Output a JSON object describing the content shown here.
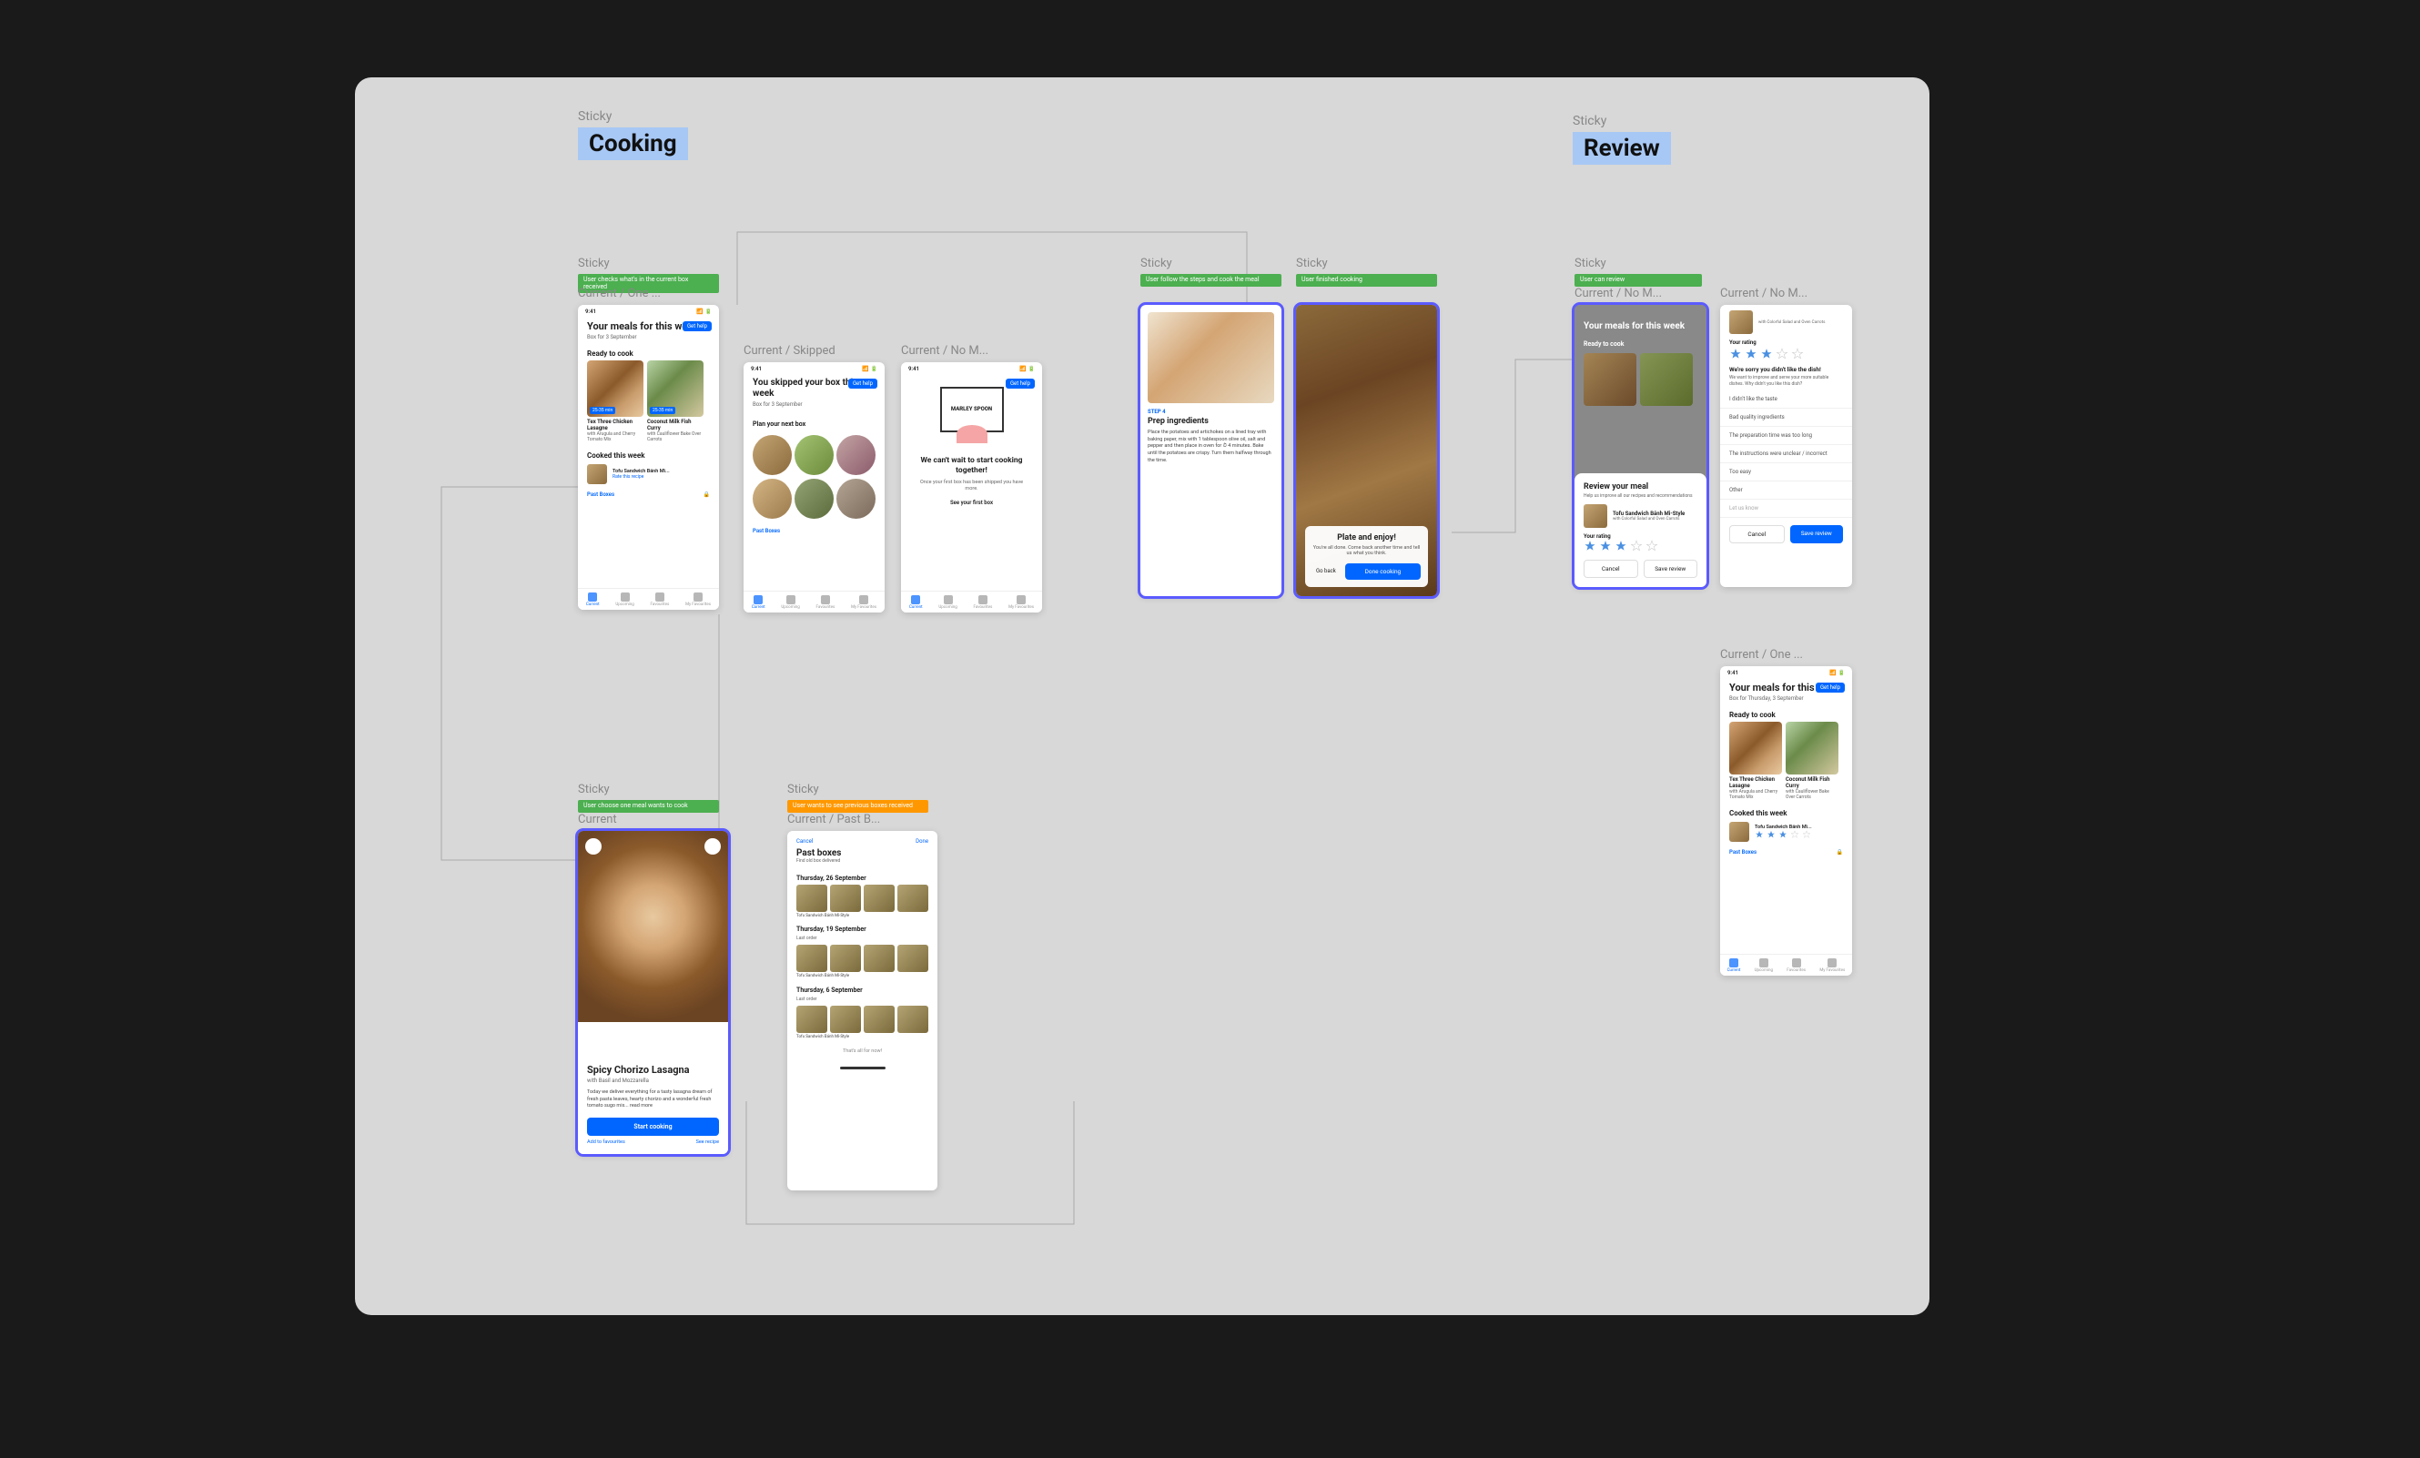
{
  "sections": {
    "cooking": {
      "sticky_label": "Sticky",
      "title": "Cooking"
    },
    "review": {
      "sticky_label": "Sticky",
      "title": "Review"
    }
  },
  "stickies": {
    "s1": {
      "label": "Sticky",
      "text": "User checks what's in the current box received"
    },
    "s2": {
      "label": "Sticky",
      "text": "User follow the steps and cook the meal"
    },
    "s3": {
      "label": "Sticky",
      "text": "User finished cooking"
    },
    "s4": {
      "label": "Sticky",
      "text": "User can review"
    },
    "s5": {
      "label": "Sticky",
      "text": "User choose one meal wants to cook"
    },
    "s6": {
      "label": "Sticky",
      "text": "User wants to see previous boxes received"
    }
  },
  "frames": {
    "f1": {
      "label": "Current / One ...",
      "time": "9:41",
      "title": "Your meals for this week",
      "sub": "Box for 3 September",
      "get_help": "Get help",
      "ready": "Ready to cook",
      "meal1": {
        "name": "Tex Three Chicken Lasagne",
        "desc": "with Arugula and Cherry Tomato Mix",
        "badge": "25-35 min"
      },
      "meal2": {
        "name": "Coconut Milk Fish Curry",
        "desc": "with Cauliflower Bake Over Carrots",
        "badge": "25-35 min"
      },
      "cooked_h": "Cooked this week",
      "cooked_name": "Tofu Sandwich Bánh Mì...",
      "cooked_link": "Rate this recipe",
      "past": "Past Boxes",
      "tabs": [
        "Current",
        "Upcoming",
        "Favourites",
        "My Favourites"
      ]
    },
    "f2": {
      "label": "Current / Skipped",
      "time": "9:41",
      "title": "You skipped your box this week",
      "sub": "Box for 3 September",
      "plan": "Plan your next box",
      "past": "Past Boxes"
    },
    "f3": {
      "label": "Current / No M...",
      "time": "9:41",
      "brand": "MARLEY SPOON",
      "headline": "We can't wait to start cooking together!",
      "body": "Once your first box has been shipped you have more.",
      "cta": "See your first box"
    },
    "f4": {
      "step_tag": "STEP 4",
      "step_title": "Prep ingredients",
      "step_body": "Place the potatoes and artichokes on a lined tray with baking paper, mix with 1 tablespoon olive oil, salt and pepper and then place in oven for ⏱ 4 minutes. Bake until the potatoes are crispy. Turn them halfway through the time."
    },
    "f5": {
      "title": "Plate and enjoy!",
      "body": "You're all done. Come back another time and tell us what you think.",
      "back": "Go back",
      "done": "Done cooking"
    },
    "f6": {
      "label": "Current / No M...",
      "modal_title": "Review your meal",
      "modal_sub": "Help us improve all our recipes and recommendations",
      "meal": "Tofu Sandwich Bánh Mì-Style",
      "meal_sub": "with Colorful Salad and Oven Carrots",
      "rating_label": "Your rating",
      "cancel": "Cancel",
      "save": "Save review"
    },
    "f7": {
      "label": "Current / No M...",
      "meal_sub": "with Colorful Salad and Oven Carrots",
      "rating_label": "Your rating",
      "sorry": "We're sorry you didn't like the dish!",
      "sorry_sub": "We want to improve and serve your more suitable dishes. Why didn't you like this dish?",
      "opts": [
        "I didn't like the taste",
        "Bad quality ingredients",
        "The preparation time was too long",
        "The instructions were unclear / incorrect",
        "Too easy",
        "Other",
        "Let us know"
      ],
      "cancel": "Cancel",
      "save": "Save review"
    },
    "f8": {
      "label": "Current",
      "title": "Spicy Chorizo Lasagna",
      "sub": "with Basil and Mozzarella",
      "body": "Today we deliver everything for a tasty lasagna dream of fresh pasta leaves, hearty chorizo and a wonderful fresh tomato sugo mix... read more",
      "btn": "Start cooking",
      "link1": "Add to favourites",
      "link2": "See recipe"
    },
    "f9": {
      "label": "Current / Past B...",
      "cancel": "Cancel",
      "done": "Done",
      "title": "Past boxes",
      "sub": "Find old box delivered",
      "dates": [
        "Thursday, 26 September",
        "Thursday, 19 September",
        "Thursday, 6 September"
      ],
      "last_order": "Last order",
      "meal": "Tofu Sandwich Bánh Mì-Style",
      "footer": "That's all for now!"
    },
    "f10": {
      "label": "Current / One ...",
      "time": "9:41",
      "title": "Your meals for this week",
      "sub": "Box for Thursday, 3 September",
      "ready": "Ready to cook",
      "meal1": {
        "name": "Tex Three Chicken Lasagne",
        "desc": "with Arugula and Cherry Tomato Mix"
      },
      "meal2": {
        "name": "Coconut Milk Fish Curry",
        "desc": "with Cauliflower Bake Over Carrots"
      },
      "cooked_h": "Cooked this week",
      "cooked_name": "Tofu Sandwich Bánh Mì...",
      "past": "Past Boxes"
    }
  }
}
